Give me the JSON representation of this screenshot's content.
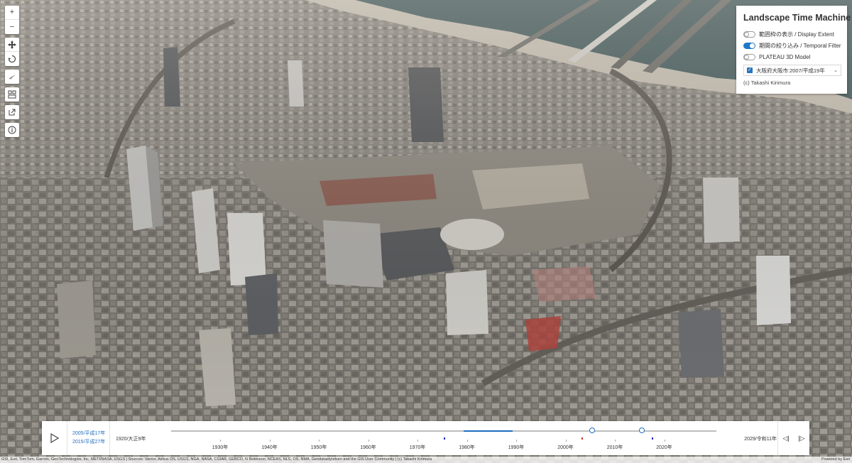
{
  "map": {
    "description_icon": "aerial-3d-city-scene"
  },
  "toolbar": {
    "zoom_in": "+",
    "zoom_out": "−",
    "icons": [
      "plus-icon",
      "minus-icon",
      "pan-icon",
      "rotate-icon",
      "compass-icon",
      "layers-icon",
      "share-icon",
      "info-icon"
    ]
  },
  "panel": {
    "title": "Landscape Time Machine",
    "toggles": [
      {
        "label": "範囲枠の表示 / Display Extent",
        "on": false
      },
      {
        "label": "期間の絞り込み / Temporal Filter",
        "on": true
      },
      {
        "label": "PLATEAU 3D Model",
        "on": false
      }
    ],
    "dataset": {
      "label": "大阪府大阪市:2007/平成19年",
      "checked": true
    },
    "credit": "(c) Takashi Kirimura"
  },
  "timeslider": {
    "range_start": "2005/平成17年",
    "range_end": "2015/平成27年",
    "min_label": "1920/大正9年",
    "max_label": "2029/令和11年",
    "ticks": [
      "1930年",
      "1940年",
      "1950年",
      "1960年",
      "1970年",
      "1980年",
      "1990年",
      "2000年",
      "2010年",
      "2020年"
    ]
  },
  "attribution": {
    "text": "GSI, Esri, TomTom, Garmin, GeoTechnologies, Inc, METI/NASA, USGS | Sources: Vantor, Airbus DS, USGS, NGA, NASA, CGIAR, GEBCO, N Robinson, NCEAS, NLS, OS, NMA, Geodatastyrelsen and the GIS User Community | (c) Takashi Kirimura",
    "powered": "Powered by Esri"
  },
  "colors": {
    "accent": "#1f6fc0",
    "river": "#3d5658",
    "city": "#7c7872"
  }
}
